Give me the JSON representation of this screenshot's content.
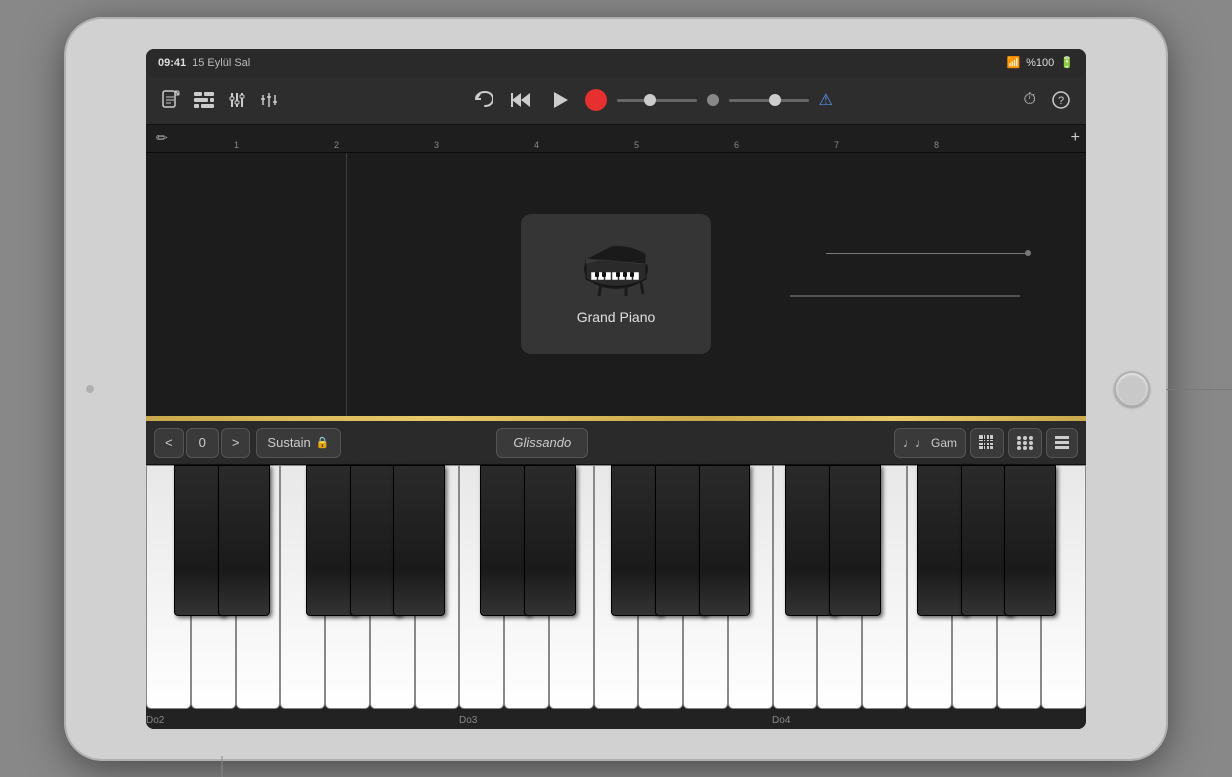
{
  "status": {
    "time": "09:41",
    "date": "15 Eylül Sal",
    "wifi": "wifi",
    "battery": "%100"
  },
  "toolbar": {
    "undo_label": "↩",
    "rewind_label": "⏮",
    "play_label": "▶",
    "record_label": "",
    "metronome_label": "⚠",
    "clock_label": "⏱",
    "help_label": "?"
  },
  "timeline": {
    "marks": [
      "1",
      "2",
      "3",
      "4",
      "5",
      "6",
      "7",
      "8"
    ],
    "plus_label": "+"
  },
  "instrument": {
    "name": "Grand Piano",
    "icon": "🎹"
  },
  "controls": {
    "prev_octave": "<",
    "octave_num": "0",
    "next_octave": ">",
    "sustain_label": "Sustain",
    "glissando_label": "Glissando",
    "scale_label": "Gam",
    "key_labels": [
      "Do2",
      "Do3",
      "Do4"
    ]
  },
  "icons": {
    "notes_icon": "♩♩",
    "grid_icon": "▦",
    "dots_icon": "⁘",
    "list_icon": "≡"
  }
}
